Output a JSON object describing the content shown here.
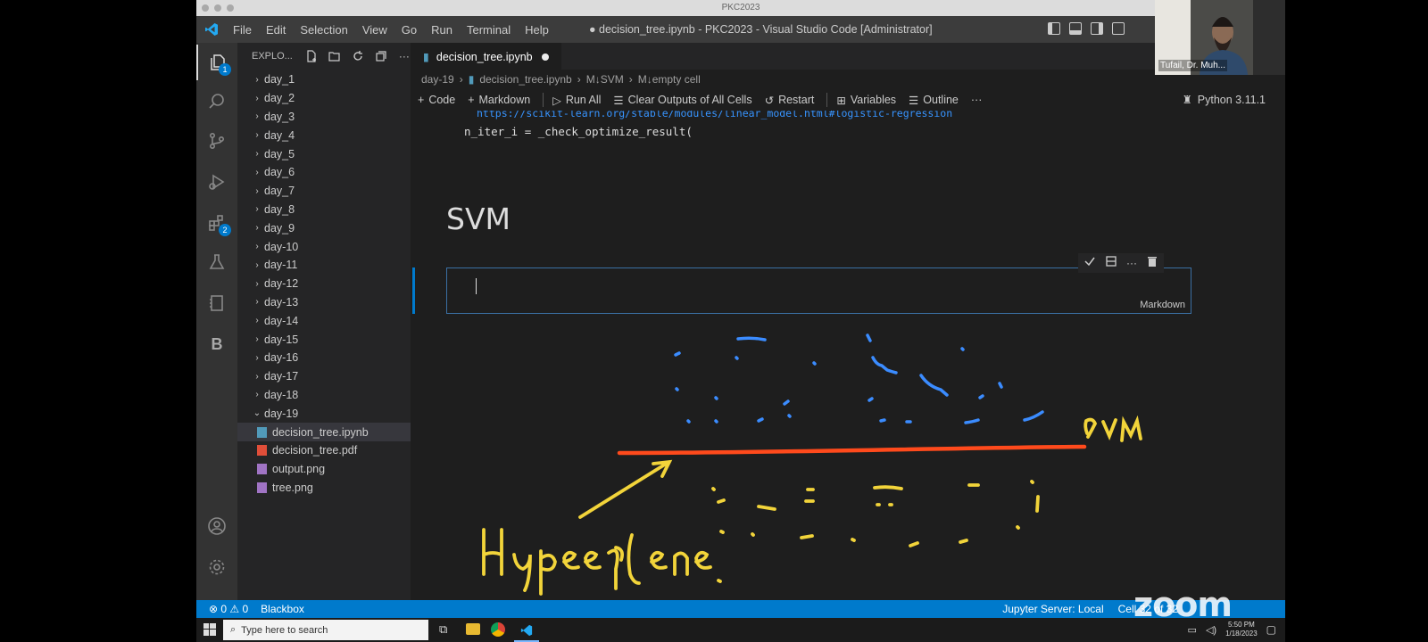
{
  "mac": {
    "title": "PKC2023"
  },
  "titlebar": {
    "menu": [
      "File",
      "Edit",
      "Selection",
      "View",
      "Go",
      "Run",
      "Terminal",
      "Help"
    ],
    "window_title": "● decision_tree.ipynb - PKC2023 - Visual Studio Code [Administrator]"
  },
  "activity": {
    "explorer_badge": "1",
    "extensions_badge": "2",
    "letter": "B"
  },
  "sidebar": {
    "title": "EXPLO...",
    "folders": [
      "day_1",
      "day_2",
      "day_3",
      "day_4",
      "day_5",
      "day_6",
      "day_7",
      "day_8",
      "day_9",
      "day-10",
      "day-11",
      "day-12",
      "day-13",
      "day-14",
      "day-15",
      "day-16",
      "day-17",
      "day-18",
      "day-19"
    ],
    "files": [
      "decision_tree.ipynb",
      "decision_tree.pdf",
      "output.png",
      "tree.png"
    ]
  },
  "tab": {
    "label": "decision_tree.ipynb"
  },
  "breadcrumb": {
    "folder": "day-19",
    "file": "decision_tree.ipynb",
    "md1": "M↓SVM",
    "md2": "M↓empty cell"
  },
  "toolbar": {
    "code": "Code",
    "markdown": "Markdown",
    "run_all": "Run All",
    "clear": "Clear Outputs of All Cells",
    "restart": "Restart",
    "variables": "Variables",
    "outline": "Outline",
    "more": "···",
    "kernel": "Python 3.11.1"
  },
  "notebook": {
    "link": "https://scikit-learn.org/stable/modules/linear_model.html#logistic-regression",
    "code": "n_iter_i = _check_optimize_result(",
    "heading": "SVM",
    "cell_lang": "Markdown"
  },
  "annotation": {
    "label_svm": "SVM",
    "label_hyperplane": "Hyperplane"
  },
  "status": {
    "problems": "⊗ 0 ⚠ 0",
    "extension": "Blackbox",
    "jupyter": "Jupyter Server: Local",
    "cell": "Cell 32 of 32"
  },
  "taskbar": {
    "search_placeholder": "Type here to search",
    "time": "5:50 PM",
    "date": "1/18/2023"
  },
  "zoom": {
    "participant": "Tufail, Dr. Muh...",
    "logo": "zoom"
  },
  "colors": {
    "accent": "#007acc",
    "annot_blue": "#3b8cff",
    "annot_red": "#ff4a1c",
    "annot_yellow": "#f2d43a"
  }
}
